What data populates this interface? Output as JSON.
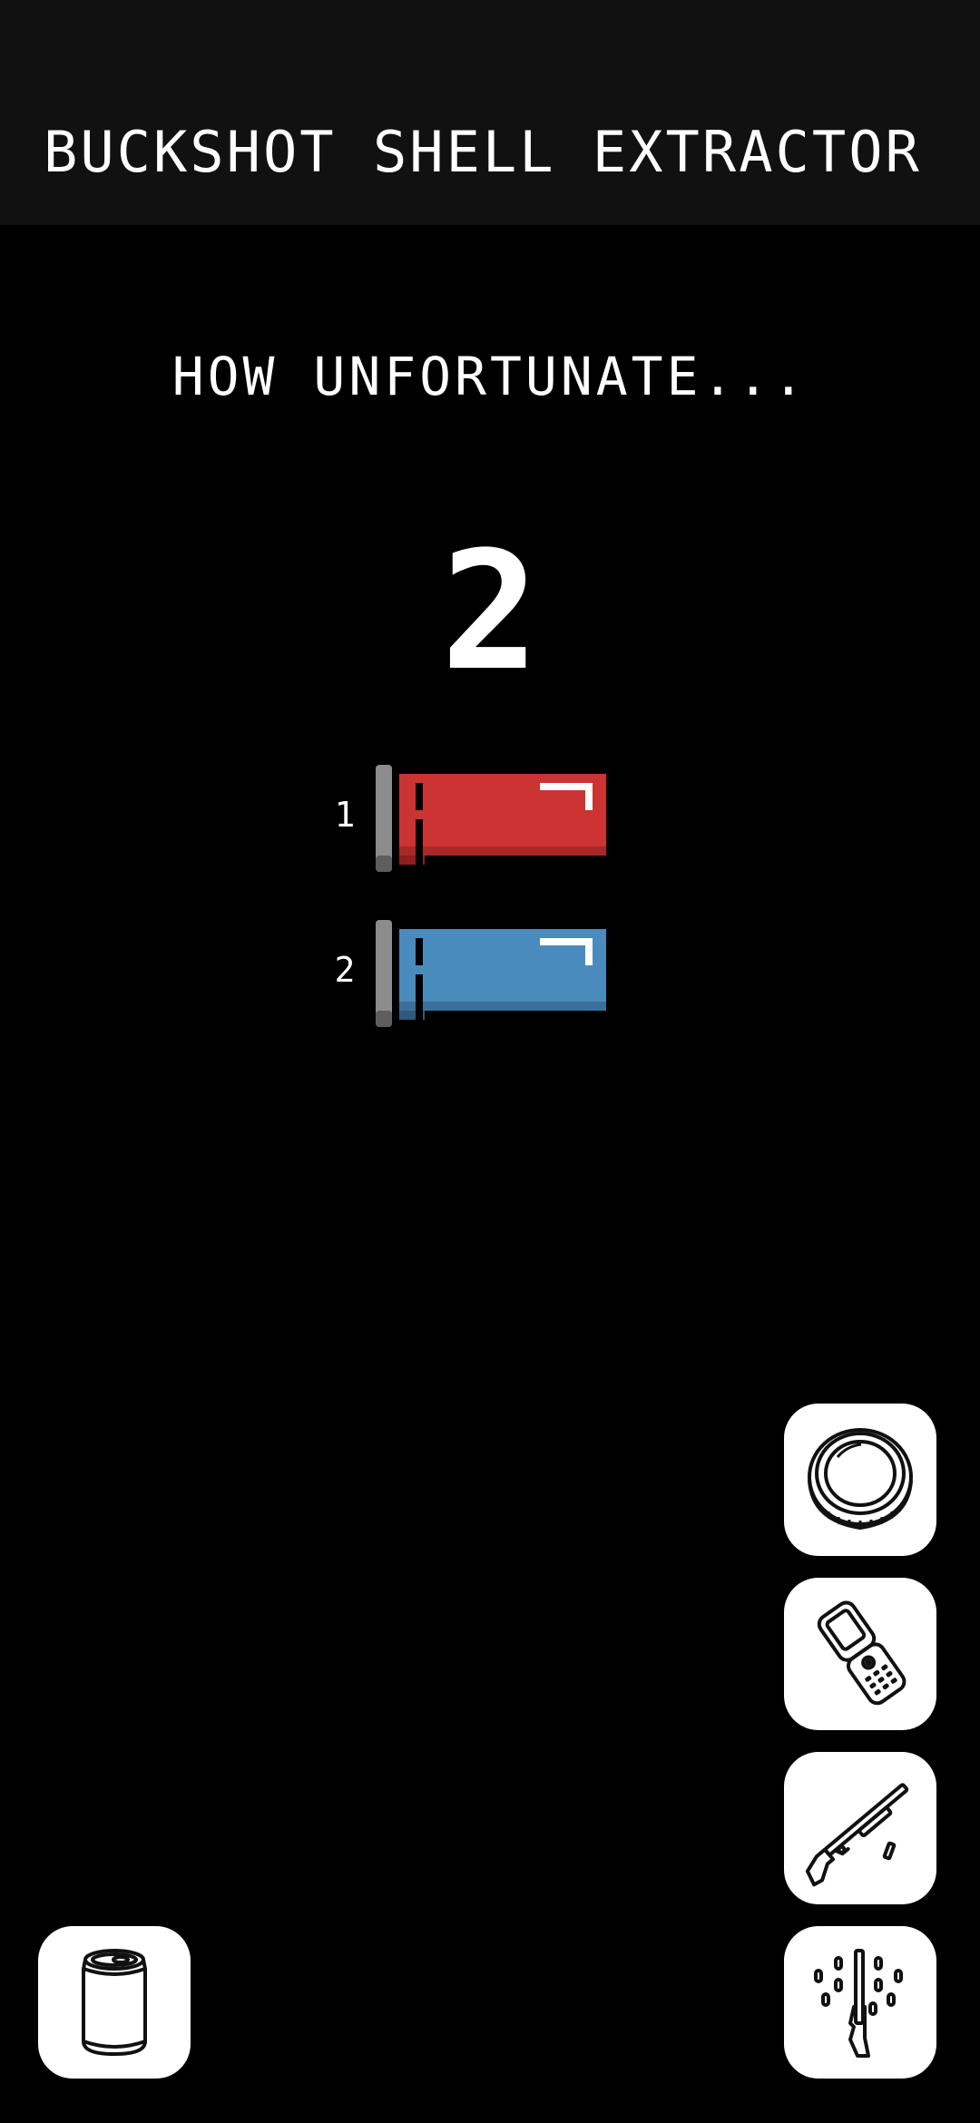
{
  "header": {
    "title": "BUCKSHOT SHELL EXTRACTOR",
    "background": "#111111"
  },
  "status": {
    "message": "HOW UNFORTUNATE..."
  },
  "shell_count": "2",
  "shells": [
    {
      "index": "1",
      "type": "live",
      "color": "#cc3333"
    },
    {
      "index": "2",
      "type": "blank",
      "color": "#4a8bbd"
    }
  ],
  "item_buttons": [
    {
      "name": "coin",
      "icon": "coin-icon"
    },
    {
      "name": "phone",
      "icon": "burner-phone-icon"
    },
    {
      "name": "shotgun",
      "icon": "shotgun-icon"
    },
    {
      "name": "shells",
      "icon": "shotgun-shells-icon"
    },
    {
      "name": "beer",
      "icon": "beer-can-icon"
    }
  ]
}
